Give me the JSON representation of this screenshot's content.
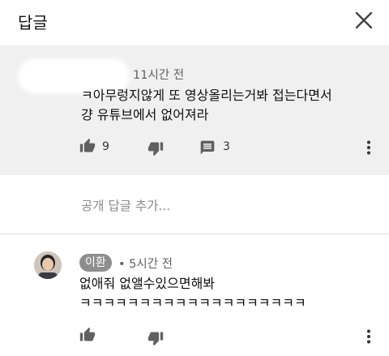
{
  "header": {
    "title": "답글",
    "close_icon": "close-icon"
  },
  "top_comment": {
    "time": "11시간 전",
    "text_line1": "ㅋ아무렁지않게 또 영상올리는거봐 접는다면서",
    "text_line2": "걍 유튜브에서 없어져라",
    "likes": "9",
    "replies": "3",
    "icons": [
      "thumb-up-icon",
      "thumb-down-icon",
      "comment-icon",
      "more-vert-icon"
    ]
  },
  "add_reply": {
    "placeholder": "공개 답글 추가..."
  },
  "reply": {
    "author": "이환",
    "time": "• 5시간 전",
    "text_line1": "없애줘 없앨수있으면해봐",
    "text_line2": "ㅋㅋㅋㅋㅋㅋㅋㅋㅋㅋㅋㅋㅋㅋㅋㅋㅋㅋㅋ",
    "icons": [
      "thumb-up-icon",
      "thumb-down-icon",
      "more-vert-icon"
    ]
  },
  "colors": {
    "highlight_bg": "#f0f0f0",
    "secondary_text": "#606060",
    "badge_bg": "#8e8e8e"
  }
}
